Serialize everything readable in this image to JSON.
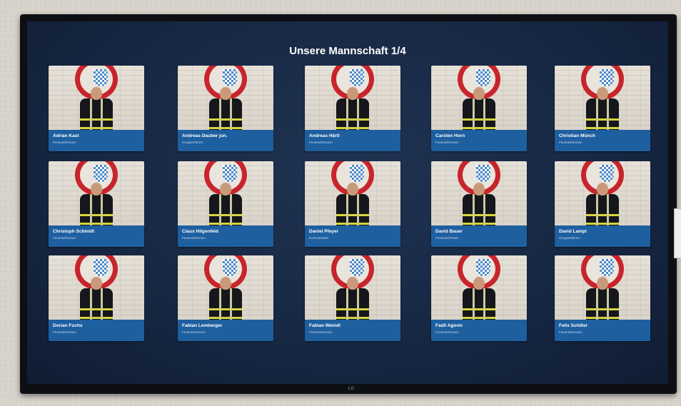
{
  "title": "Unsere Mannschaft 1/4",
  "tv_brand": "LG",
  "colors": {
    "screen_bg": "#172844",
    "card_caption": "#1e5fa0",
    "emblem_red": "#c8242b",
    "emblem_blue": "#4a87c8",
    "uniform": "#15171c",
    "reflective": "#d6d63a"
  },
  "members": [
    {
      "name": "Adrian Kast",
      "role": "Feuerwehrmann"
    },
    {
      "name": "Andreas Dauber jun.",
      "role": "Gruppenführer"
    },
    {
      "name": "Andreas Härtl",
      "role": "Feuerwehrmann"
    },
    {
      "name": "Carsten Horn",
      "role": "Feuerwehrmann"
    },
    {
      "name": "Christian Münch",
      "role": "Feuerwehrmann"
    },
    {
      "name": "Christoph Schmidt",
      "role": "Feuerwehrmann"
    },
    {
      "name": "Claus Hilgenfeld",
      "role": "Feuerwehrmann"
    },
    {
      "name": "Daniel Pfeyer",
      "role": "Kommandant"
    },
    {
      "name": "David Bauer",
      "role": "Feuerwehrmann"
    },
    {
      "name": "David Lampl",
      "role": "Gruppenführer"
    },
    {
      "name": "Dorian Fuchs",
      "role": "Feuerwehrmann"
    },
    {
      "name": "Fabian Lemberger",
      "role": "Feuerwehrmann"
    },
    {
      "name": "Fabian Weindl",
      "role": "Feuerwehrmann"
    },
    {
      "name": "Fadil Agovic",
      "role": "Feuerwehrmann"
    },
    {
      "name": "Felix Schiller",
      "role": "Feuerwehrmann"
    }
  ]
}
